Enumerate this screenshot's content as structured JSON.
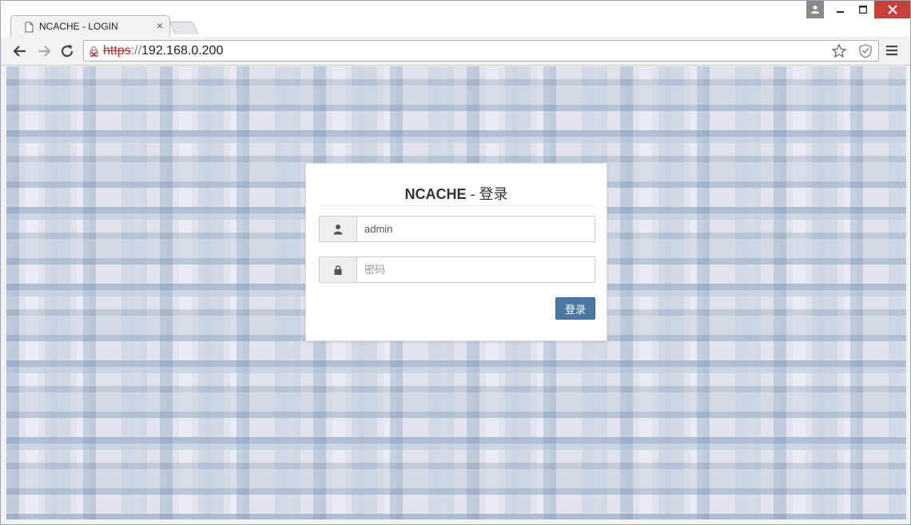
{
  "tab": {
    "title": "NCACHE - LOGIN",
    "close": "×",
    "icon": "page-icon"
  },
  "window_controls": {
    "user": "user-icon",
    "minimize": "minimize-icon",
    "maximize": "maximize-icon",
    "close": "close-icon"
  },
  "toolbar": {
    "back_icon": "back-arrow-icon",
    "forward_icon": "forward-arrow-icon",
    "reload_icon": "reload-icon",
    "url_protocol": "https",
    "url_separator": "://",
    "url_host": "192.168.0.200",
    "bookmark_icon": "star-icon",
    "extension_icon": "shield-icon",
    "menu_icon": "hamburger-menu-icon"
  },
  "login": {
    "brand": "NCACHE",
    "title_suffix": " - 登录",
    "username_value": "admin",
    "password_placeholder": "密码",
    "submit_label": "登录"
  },
  "colors": {
    "accent": "#4a77a3",
    "insecure": "#c2272d",
    "close_button": "#c9403a"
  }
}
